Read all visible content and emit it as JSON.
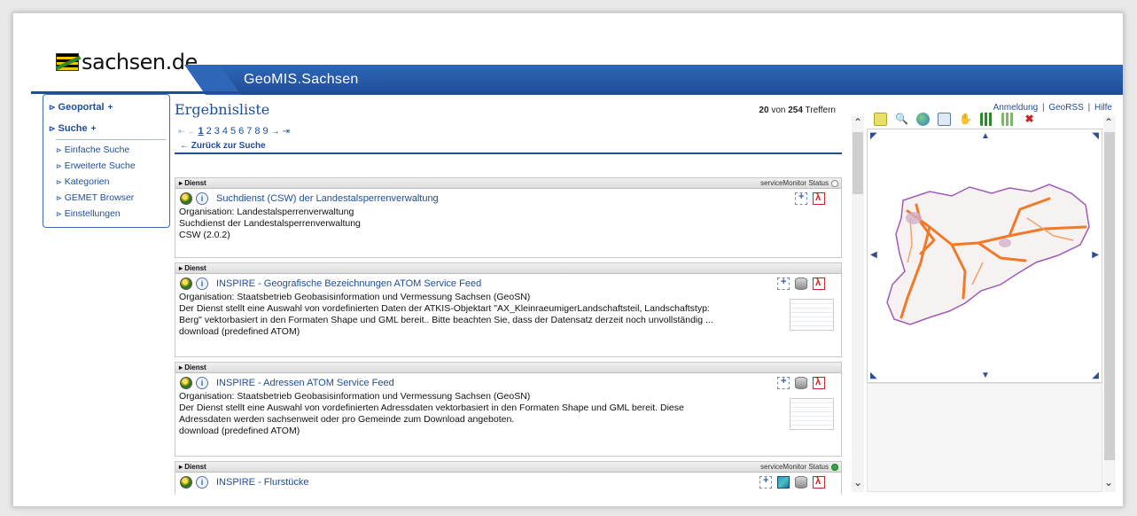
{
  "header": {
    "logo_text": "sachsen.de",
    "banner_title": "GeoMIS.Sachsen"
  },
  "top_links": {
    "login": "Anmeldung",
    "separator": "|",
    "georss": "GeoRSS",
    "help": "Hilfe"
  },
  "sidenav": {
    "main": [
      {
        "label": "Geoportal",
        "suffix": "+"
      },
      {
        "label": "Suche",
        "suffix": "+"
      }
    ],
    "sub": [
      {
        "label": "Einfache Suche"
      },
      {
        "label": "Erweiterte Suche"
      },
      {
        "label": "Kategorien"
      },
      {
        "label": "GEMET Browser"
      },
      {
        "label": "Einstellungen"
      }
    ]
  },
  "results": {
    "title": "Ergebnisliste",
    "count_shown": "20",
    "count_of": "von",
    "count_total": "254",
    "count_suffix": "Treffern",
    "pager": {
      "first": "⇤",
      "prev": "←",
      "pages": [
        "1",
        "2",
        "3",
        "4",
        "5",
        "6",
        "7",
        "8",
        "9"
      ],
      "current": "1",
      "next": "→",
      "last": "⇥"
    },
    "back_label": "← Zurück zur Suche",
    "items": [
      {
        "type": "Dienst",
        "status_label": "serviceMonitor Status",
        "status_color": "#ffffff",
        "title": "Suchdienst (CSW) der Landestalsperrenverwaltung",
        "lines": [
          "Organisation: Landestalsperrenverwaltung",
          "Suchdienst der Landestalsperrenverwaltung",
          "CSW (2.0.2)"
        ],
        "icons": [
          "zoom-icon",
          "pdf-icon"
        ]
      },
      {
        "type": "Dienst",
        "status_label": "",
        "title": "INSPIRE - Geografische Bezeichnungen ATOM Service Feed",
        "lines": [
          "Organisation: Staatsbetrieb Geobasisinformation und Vermessung Sachsen (GeoSN)",
          "Der Dienst stellt eine Auswahl von vordefinierten Daten der ATKIS-Objektart \"AX_KleinraeumigerLandschaftsteil, Landschaftstyp:",
          "Berg\" vektorbasiert in den Formaten Shape und GML bereit.. Bitte beachten Sie, dass der Datensatz derzeit noch unvollständig ...",
          "download (predefined ATOM)"
        ],
        "icons": [
          "zoom-icon",
          "database-icon",
          "pdf-icon"
        ]
      },
      {
        "type": "Dienst",
        "status_label": "",
        "title": "INSPIRE - Adressen ATOM Service Feed",
        "lines": [
          "Organisation: Staatsbetrieb Geobasisinformation und Vermessung Sachsen (GeoSN)",
          "Der Dienst stellt eine Auswahl von vordefinierten Adressdaten vektorbasiert in den Formaten Shape und GML bereit. Diese",
          "Adressdaten werden sachsenweit oder pro Gemeinde zum Download angeboten.",
          "download (predefined ATOM)"
        ],
        "icons": [
          "zoom-icon",
          "database-icon",
          "pdf-icon"
        ]
      },
      {
        "type": "Dienst",
        "status_label": "serviceMonitor Status",
        "status_color": "#2fa83f",
        "title": "INSPIRE - Flurstücke",
        "lines": [],
        "icons": [
          "zoom-icon",
          "map-icon",
          "database-icon",
          "pdf-icon"
        ]
      }
    ]
  },
  "map": {
    "tools": [
      "select-tool-icon",
      "zoom-out-icon",
      "globe-icon",
      "window-icon",
      "pan-hand-icon",
      "grid-select-icon",
      "grid-deselect-icon",
      "delete-icon"
    ],
    "colors": {
      "roads": "#f07a2a",
      "border": "#a05ab8",
      "land": "#f7f2f2"
    }
  }
}
